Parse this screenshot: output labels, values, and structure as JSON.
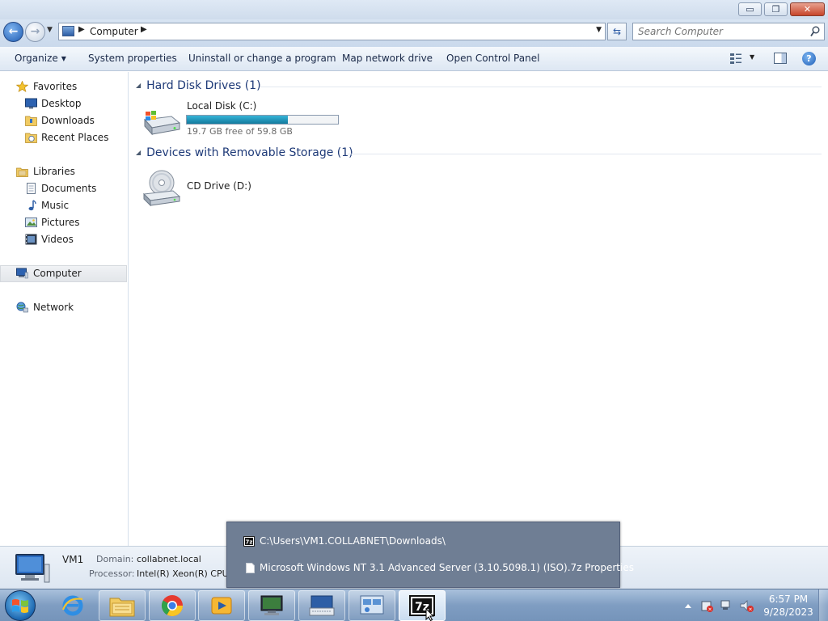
{
  "titlebar": {
    "minimize": "▭",
    "restore": "❐",
    "close": "✕"
  },
  "address": {
    "path": "Computer",
    "sep": "▶",
    "sep_after": "▶",
    "drop": "▼"
  },
  "search": {
    "placeholder": "Search Computer"
  },
  "commands": {
    "organize": "Organize",
    "system_properties": "System properties",
    "uninstall": "Uninstall or change a program",
    "map_drive": "Map network drive",
    "control_panel": "Open Control Panel"
  },
  "nav": {
    "favorites": "Favorites",
    "desktop": "Desktop",
    "downloads": "Downloads",
    "recent_places": "Recent Places",
    "libraries": "Libraries",
    "documents": "Documents",
    "music": "Music",
    "pictures": "Pictures",
    "videos": "Videos",
    "computer": "Computer",
    "network": "Network"
  },
  "groups": {
    "hard_disks": {
      "title": "Hard Disk Drives (1)"
    },
    "removable": {
      "title": "Devices with Removable Storage (1)"
    }
  },
  "drives": {
    "c": {
      "name": "Local Disk (C:)",
      "free_text": "19.7 GB free of 59.8 GB",
      "used_fraction": 0.67
    },
    "d": {
      "name": "CD Drive (D:)"
    }
  },
  "details": {
    "name": "VM1",
    "domain_label": "Domain:",
    "domain_value": "collabnet.local",
    "processor_label": "Processor:",
    "processor_value": "Intel(R) Xeon(R) CPU"
  },
  "popup": {
    "folder": "C:\\Users\\VM1.COLLABNET\\Downloads\\",
    "file": "Microsoft Windows NT 3.1 Advanced Server (3.10.5098.1) (ISO).7z Properties"
  },
  "taskbar": {
    "sevenzip_label": "7z",
    "time": "6:57 PM",
    "date": "9/28/2023"
  },
  "colors": {
    "accent_blue": "#1e3a78",
    "drive_fill": "#1e8fb5",
    "taskbar": "#7f9dc2"
  }
}
